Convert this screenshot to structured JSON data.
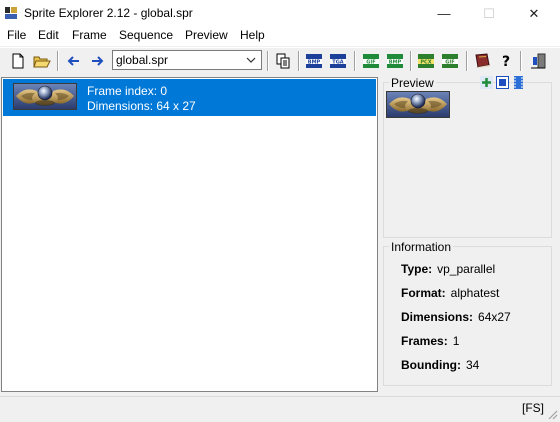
{
  "window": {
    "title": "Sprite Explorer 2.12 - global.spr",
    "minimize_glyph": "—",
    "maximize_glyph": "☐",
    "close_glyph": "✕"
  },
  "menu": [
    "File",
    "Edit",
    "Frame",
    "Sequence",
    "Preview",
    "Help"
  ],
  "toolbar": {
    "file_selector_value": "global.spr",
    "icons": [
      "new-file-icon",
      "open-folder-icon",
      "back-arrow-icon",
      "forward-arrow-icon",
      "copy-icon",
      "export-bmp-icon",
      "export-tga-icon",
      "import-gif-icon",
      "import-bmp-icon",
      "export-pcx-icon",
      "export-gif-icon",
      "book-icon",
      "help-icon",
      "exit-icon"
    ],
    "accent_blue": "#1f4fbf"
  },
  "list": {
    "selected_color": "#0078d7",
    "items": [
      {
        "frame_index": "Frame index: 0",
        "dimensions": "Dimensions: 64 x 27"
      }
    ]
  },
  "preview": {
    "label": "Preview",
    "controls": [
      "add-icon",
      "fit-icon",
      "film-icon"
    ]
  },
  "information": {
    "label": "Information",
    "rows": [
      {
        "key": "Type:",
        "value": "vp_parallel"
      },
      {
        "key": "Format:",
        "value": "alphatest"
      },
      {
        "key": "Dimensions:",
        "value": "64x27"
      },
      {
        "key": "Frames:",
        "value": "1"
      },
      {
        "key": "Bounding:",
        "value": "34"
      }
    ]
  },
  "status": {
    "text": "[FS]"
  }
}
